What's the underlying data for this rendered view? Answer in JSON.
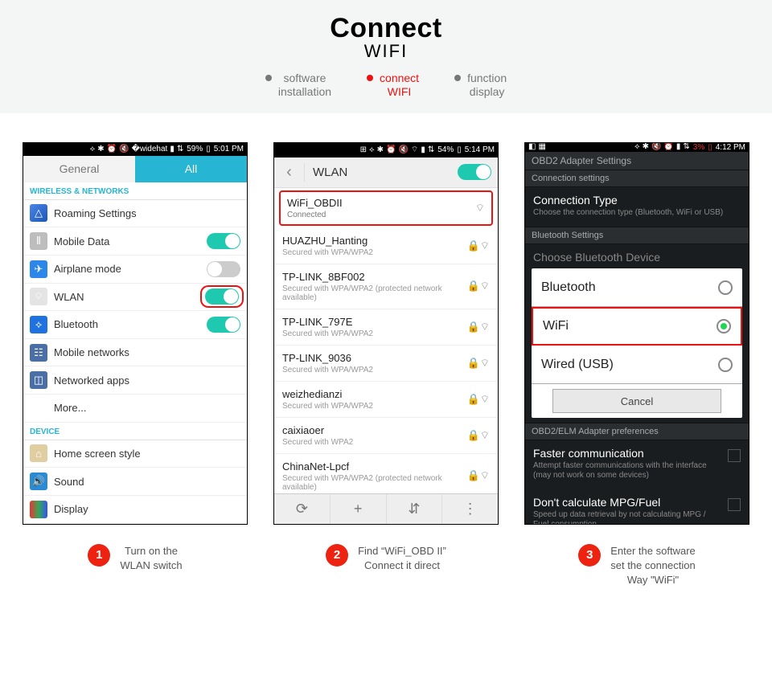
{
  "header": {
    "title": "Connect",
    "subtitle": "WIFI",
    "nav": [
      {
        "line1": "software",
        "line2": "installation"
      },
      {
        "line1": "connect",
        "line2": "WIFI"
      },
      {
        "line1": "function",
        "line2": "display"
      }
    ]
  },
  "phone1": {
    "status_time": "5:01 PM",
    "status_batt": "59%",
    "tab_general": "General",
    "tab_all": "All",
    "sect_wireless": "WIRELESS & NETWORKS",
    "rows": {
      "roaming": "Roaming Settings",
      "mobiledata": "Mobile Data",
      "airplane": "Airplane mode",
      "wlan": "WLAN",
      "bluetooth": "Bluetooth",
      "mobilenet": "Mobile networks",
      "netapps": "Networked apps",
      "more": "More..."
    },
    "sect_device": "DEVICE",
    "dev": {
      "home": "Home screen style",
      "sound": "Sound",
      "display": "Display"
    }
  },
  "phone2": {
    "status_time": "5:14 PM",
    "status_batt": "54%",
    "title": "WLAN",
    "wifi": [
      {
        "name": "WiFi_OBDII",
        "sub": "Connected",
        "connected": true
      },
      {
        "name": "HUAZHU_Hanting",
        "sub": "Secured with WPA/WPA2"
      },
      {
        "name": "TP-LINK_8BF002",
        "sub": "Secured with WPA/WPA2 (protected network available)"
      },
      {
        "name": "TP-LINK_797E",
        "sub": "Secured with WPA/WPA2"
      },
      {
        "name": "TP-LINK_9036",
        "sub": "Secured with WPA/WPA2"
      },
      {
        "name": "weizhedianzi",
        "sub": "Secured with WPA/WPA2"
      },
      {
        "name": "caixiaoer",
        "sub": "Secured with WPA2"
      },
      {
        "name": "ChinaNet-Lpcf",
        "sub": "Secured with WPA/WPA2 (protected network available)"
      }
    ]
  },
  "phone3": {
    "status_time": "4:12 PM",
    "status_batt": "3%",
    "hdr": "OBD2 Adapter Settings",
    "sect_conn": "Connection settings",
    "conntype_t": "Connection Type",
    "conntype_s": "Choose the connection type (Bluetooth, WiFi or USB)",
    "sect_bt": "Bluetooth Settings",
    "btdev": "Choose Bluetooth Device",
    "dlg": {
      "bt": "Bluetooth",
      "wifi": "WiFi",
      "wired": "Wired (USB)",
      "cancel": "Cancel"
    },
    "pref": "OBD2/ELM Adapter preferences",
    "fast_t": "Faster communication",
    "fast_s": "Attempt faster communications with the interface (may not work on some devices)",
    "mpg_t": "Don't calculate MPG/Fuel",
    "mpg_s": "Speed up data retrieval by not calculating MPG / Fuel consumption"
  },
  "captions": {
    "s1a": "Turn on the",
    "s1b": "WLAN switch",
    "s2a": "Find “WiFi_OBD II”",
    "s2b": "Connect it direct",
    "s3a": "Enter the software",
    "s3b": "set the connection",
    "s3c": "Way \"WiFi\""
  }
}
